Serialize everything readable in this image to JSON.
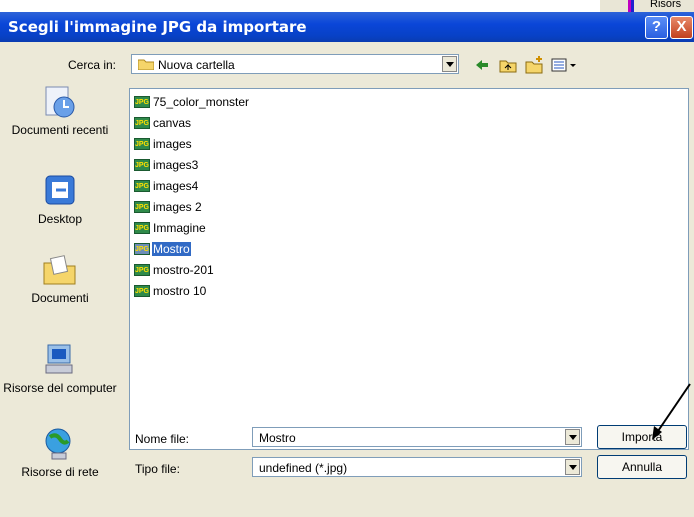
{
  "background_fragment": {
    "text": "Risors"
  },
  "titlebar": {
    "title": "Scegli l'immagine JPG da importare",
    "help_label": "?",
    "close_label": "X"
  },
  "lookin": {
    "label": "Cerca in:",
    "value": "Nuova cartella"
  },
  "places": [
    {
      "label": "Documenti recenti",
      "icon": "recent-documents-icon"
    },
    {
      "label": "Desktop",
      "icon": "desktop-icon"
    },
    {
      "label": "Documenti",
      "icon": "my-documents-icon"
    },
    {
      "label": "Risorse del computer",
      "icon": "my-computer-icon"
    },
    {
      "label": "Risorse di rete",
      "icon": "network-icon"
    }
  ],
  "files": [
    {
      "name": "75_color_monster"
    },
    {
      "name": "canvas"
    },
    {
      "name": "images"
    },
    {
      "name": "images3"
    },
    {
      "name": "images4"
    },
    {
      "name": "images 2"
    },
    {
      "name": "Immagine"
    },
    {
      "name": "Mostro",
      "selected": true
    },
    {
      "name": "mostro-201"
    },
    {
      "name": "mostro 10"
    }
  ],
  "filename": {
    "label": "Nome file:",
    "value": "Mostro"
  },
  "filetype": {
    "label": "Tipo file:",
    "value": "undefined (*.jpg)"
  },
  "buttons": {
    "import": "Importa",
    "cancel": "Annulla"
  },
  "colors": {
    "titlebar": "#0a46d8",
    "selection": "#316ac5",
    "annotation_arrow": "#000000"
  }
}
